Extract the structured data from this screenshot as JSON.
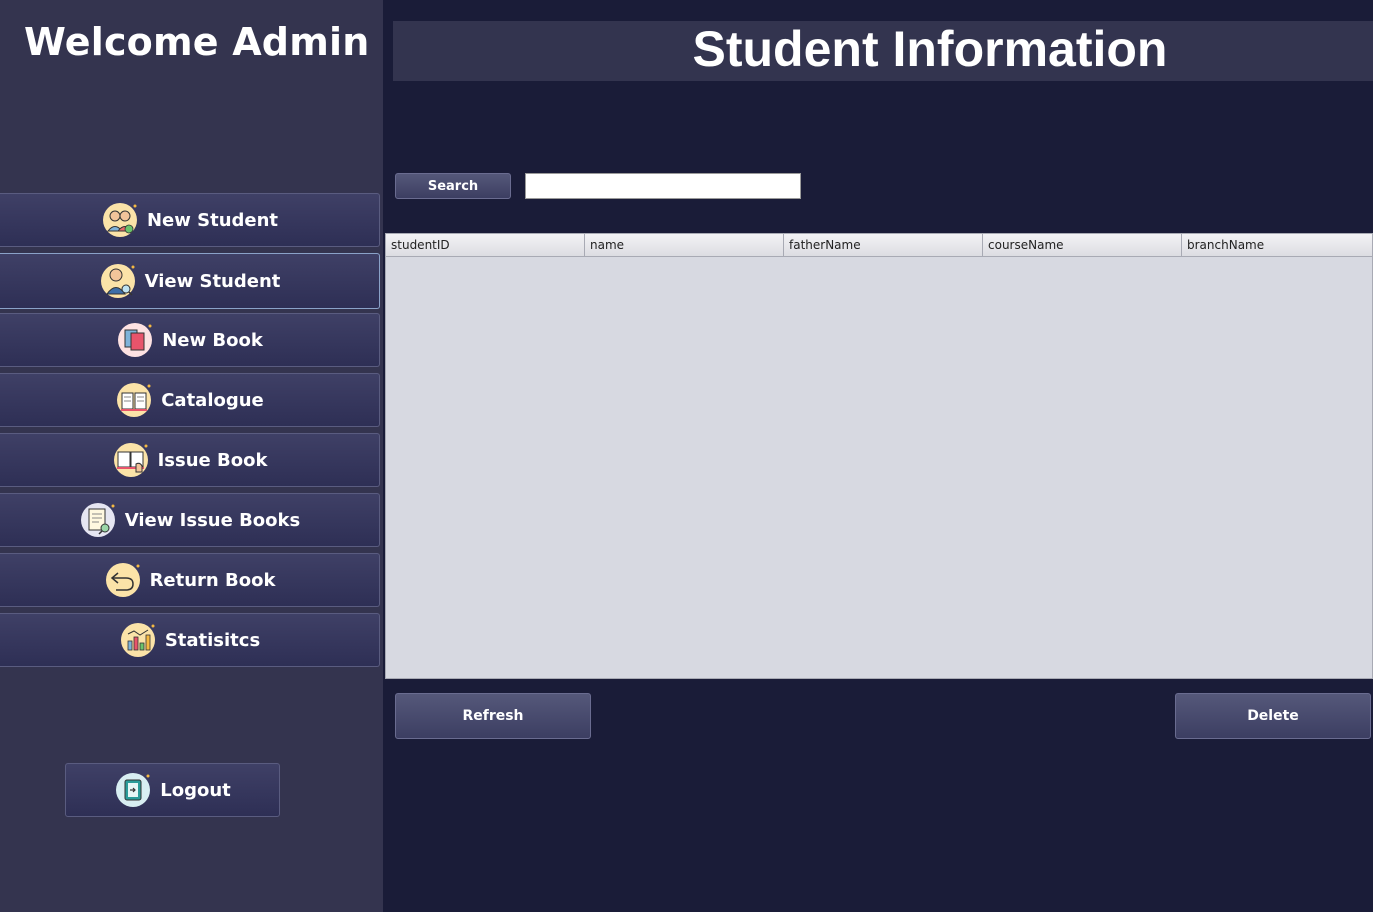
{
  "sidebar": {
    "welcome": "Welcome Admin",
    "items": [
      {
        "label": "New Student",
        "icon": "add-students-icon"
      },
      {
        "label": "View Student",
        "icon": "student-search-icon"
      },
      {
        "label": "New Book",
        "icon": "books-icon"
      },
      {
        "label": "Catalogue",
        "icon": "open-book-icon"
      },
      {
        "label": "Issue Book",
        "icon": "book-hand-icon"
      },
      {
        "label": "View Issue Books",
        "icon": "document-search-icon"
      },
      {
        "label": "Return Book",
        "icon": "return-arrow-icon"
      },
      {
        "label": "Statisitcs",
        "icon": "bar-chart-icon"
      }
    ],
    "logout": {
      "label": "Logout",
      "icon": "exit-door-icon"
    }
  },
  "main": {
    "title": "Student Information",
    "search": {
      "button_label": "Search",
      "value": ""
    },
    "table": {
      "columns": [
        "studentID",
        "name",
        "fatherName",
        "courseName",
        "branchName"
      ],
      "rows": []
    },
    "refresh_label": "Refresh",
    "delete_label": "Delete"
  },
  "colors": {
    "main_background": "#1a1c38",
    "sidebar_background": "#34344f",
    "table_background": "#d7d9e1",
    "icon_circle": "#fbe3a8"
  }
}
